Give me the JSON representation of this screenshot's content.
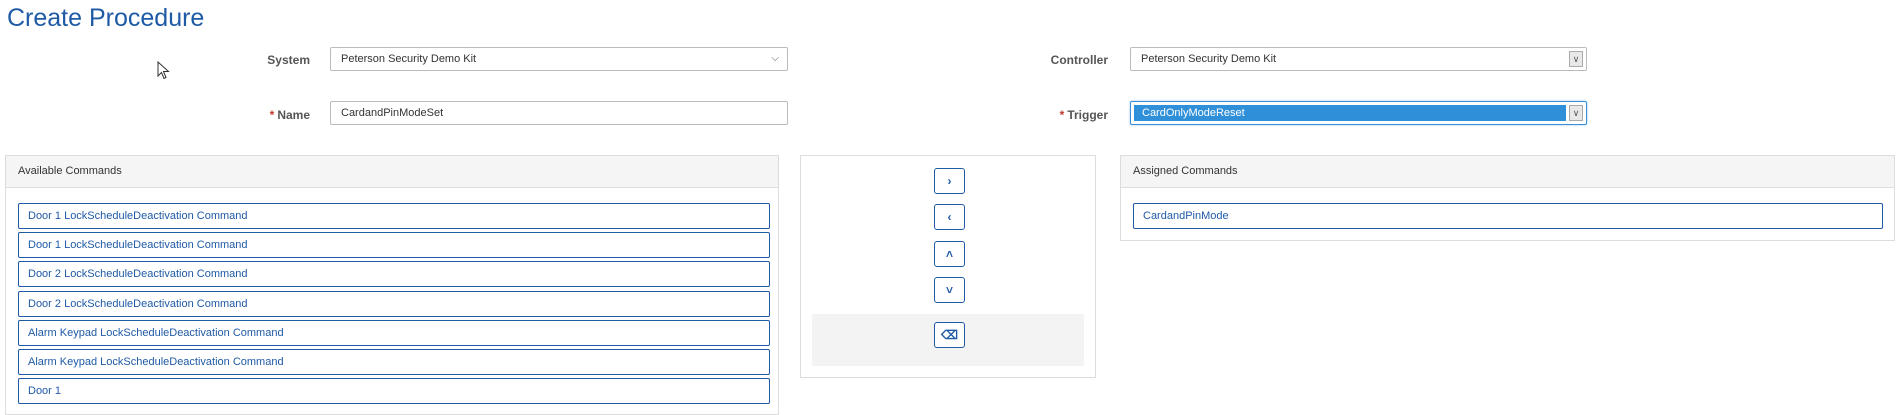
{
  "page": {
    "title": "Create Procedure"
  },
  "form": {
    "system": {
      "label": "System",
      "value": "Peterson Security Demo Kit"
    },
    "controller": {
      "label": "Controller",
      "value": "Peterson Security Demo Kit"
    },
    "name": {
      "label": "Name",
      "required_marker": "*",
      "value": "CardandPinModeSet"
    },
    "trigger": {
      "label": "Trigger",
      "required_marker": "*",
      "value": "CardOnlyModeReset"
    }
  },
  "available": {
    "title": "Available Commands",
    "items": [
      "Door 1 LockScheduleDeactivation Command",
      "Door 1 LockScheduleDeactivation Command",
      "Door 2 LockScheduleDeactivation Command",
      "Door 2 LockScheduleDeactivation Command",
      "Alarm Keypad LockScheduleDeactivation Command",
      "Alarm Keypad LockScheduleDeactivation Command",
      "Door 1"
    ]
  },
  "assigned": {
    "title": "Assigned Commands",
    "items": [
      "CardandPinMode"
    ]
  },
  "controls": {
    "move_right_glyph": "›",
    "move_left_glyph": "‹",
    "move_up_glyph": "˄",
    "move_down_glyph": "˅",
    "clear_glyph": "⌫"
  },
  "colors": {
    "accent": "#1f5aa6",
    "focus": "#2f8fd8",
    "required": "#c0392b"
  }
}
